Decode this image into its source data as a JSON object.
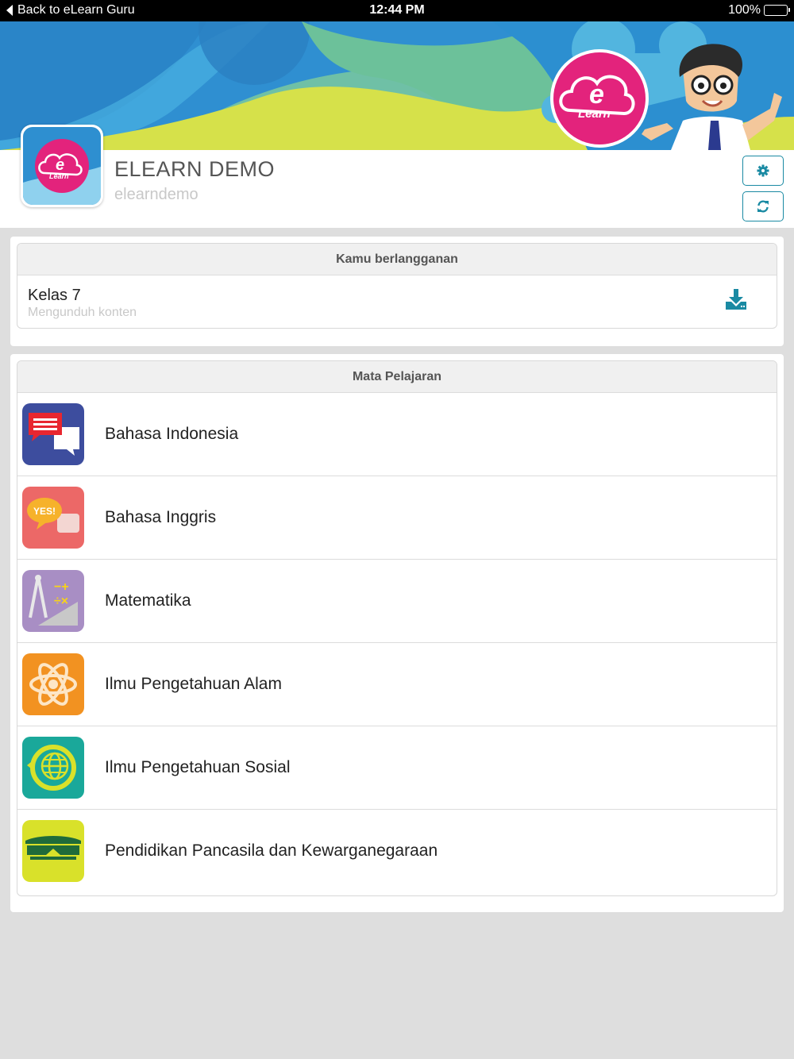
{
  "status_bar": {
    "back_label": "Back to eLearn Guru",
    "time": "12:44 PM",
    "battery": "100%"
  },
  "profile": {
    "title": "ELEARN DEMO",
    "username": "elearndemo",
    "settings_icon": "gear-icon",
    "refresh_icon": "refresh-icon"
  },
  "subscription": {
    "header": "Kamu berlangganan",
    "item_title": "Kelas 7",
    "item_status": "Mengunduh konten",
    "action_icon": "download-icon"
  },
  "subjects": {
    "header": "Mata Pelajaran",
    "items": [
      {
        "label": "Bahasa Indonesia",
        "icon": "chat-bubbles-icon",
        "color": "#3d4d9e"
      },
      {
        "label": "Bahasa Inggris",
        "icon": "yes-bubble-icon",
        "color": "#ec6867"
      },
      {
        "label": "Matematika",
        "icon": "compass-math-icon",
        "color": "#a88ec4"
      },
      {
        "label": "Ilmu Pengetahuan Alam",
        "icon": "atom-icon",
        "color": "#f29221"
      },
      {
        "label": "Ilmu Pengetahuan Sosial",
        "icon": "globe-icon",
        "color": "#1aa89a"
      },
      {
        "label": "Pendidikan Pancasila dan Kewarganegaraan",
        "icon": "building-icon",
        "color": "#d9e12a"
      }
    ]
  },
  "colors": {
    "accent": "#1a8aa3",
    "brand_pink": "#e3237c",
    "banner_blue": "#2d8fd0"
  }
}
